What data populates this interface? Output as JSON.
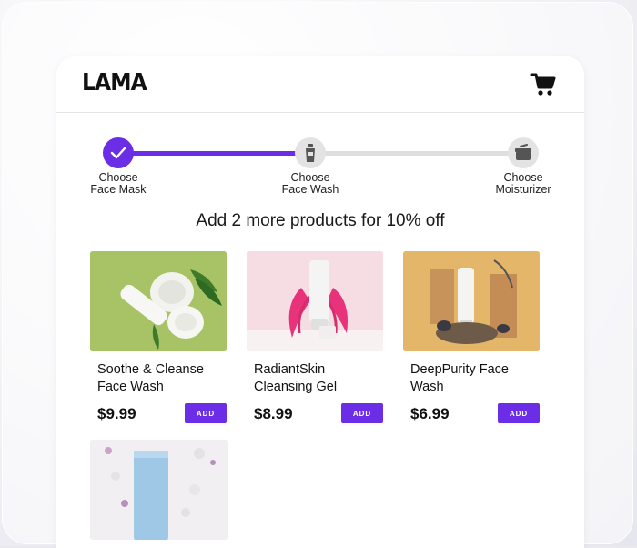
{
  "header": {
    "logo": "LAMA",
    "cart_icon": "shopping-cart-icon"
  },
  "stepper": {
    "progress_percent": 50,
    "steps": [
      {
        "label": "Choose\nFace Mask",
        "state": "completed",
        "icon": "check-icon"
      },
      {
        "label": "Choose\nFace Wash",
        "state": "current",
        "icon": "tube-icon"
      },
      {
        "label": "Choose\nMoisturizer",
        "state": "upcoming",
        "icon": "jar-icon"
      }
    ]
  },
  "promo": "Add 2 more products for 10% off",
  "products": [
    {
      "name": "Soothe & Cleanse Face Wash",
      "price": "$9.99",
      "add_label": "ADD"
    },
    {
      "name": "RadiantSkin Cleansing Gel",
      "price": "$8.99",
      "add_label": "ADD"
    },
    {
      "name": "DeepPurity Face Wash",
      "price": "$6.99",
      "add_label": "ADD"
    }
  ],
  "colors": {
    "accent": "#6b2ee6",
    "track": "#dedede"
  }
}
